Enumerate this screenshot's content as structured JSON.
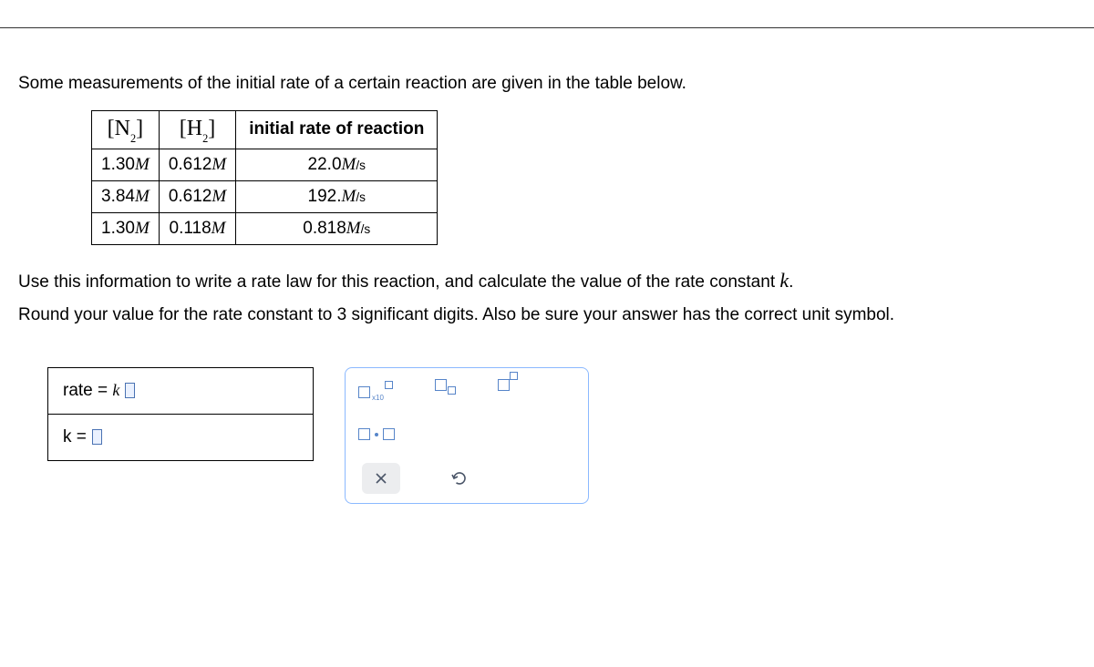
{
  "intro": "Some measurements of the initial rate of a certain reaction are given in the table below.",
  "table": {
    "headers": {
      "col1_species": "N",
      "col1_sub": "2",
      "col2_species": "H",
      "col2_sub": "2",
      "col3": "initial rate of reaction"
    },
    "rows": [
      {
        "n2": "1.30",
        "h2": "0.612",
        "rate": "22.0"
      },
      {
        "n2": "3.84",
        "h2": "0.612",
        "rate": "192."
      },
      {
        "n2": "1.30",
        "h2": "0.118",
        "rate": "0.818"
      }
    ],
    "unit_M": "M",
    "unit_rate_suffix": "/s"
  },
  "para1_a": "Use this information to write a rate law for this reaction, and calculate the value of the rate constant ",
  "para1_k": "k",
  "para1_b": ".",
  "para2": "Round your value for the rate constant to 3 significant digits. Also be sure your answer has the correct unit symbol.",
  "answer": {
    "rate_label": "rate",
    "equals": " = ",
    "k_ital": "k",
    "k_label": "k"
  },
  "tools": {
    "x10": "x10"
  }
}
